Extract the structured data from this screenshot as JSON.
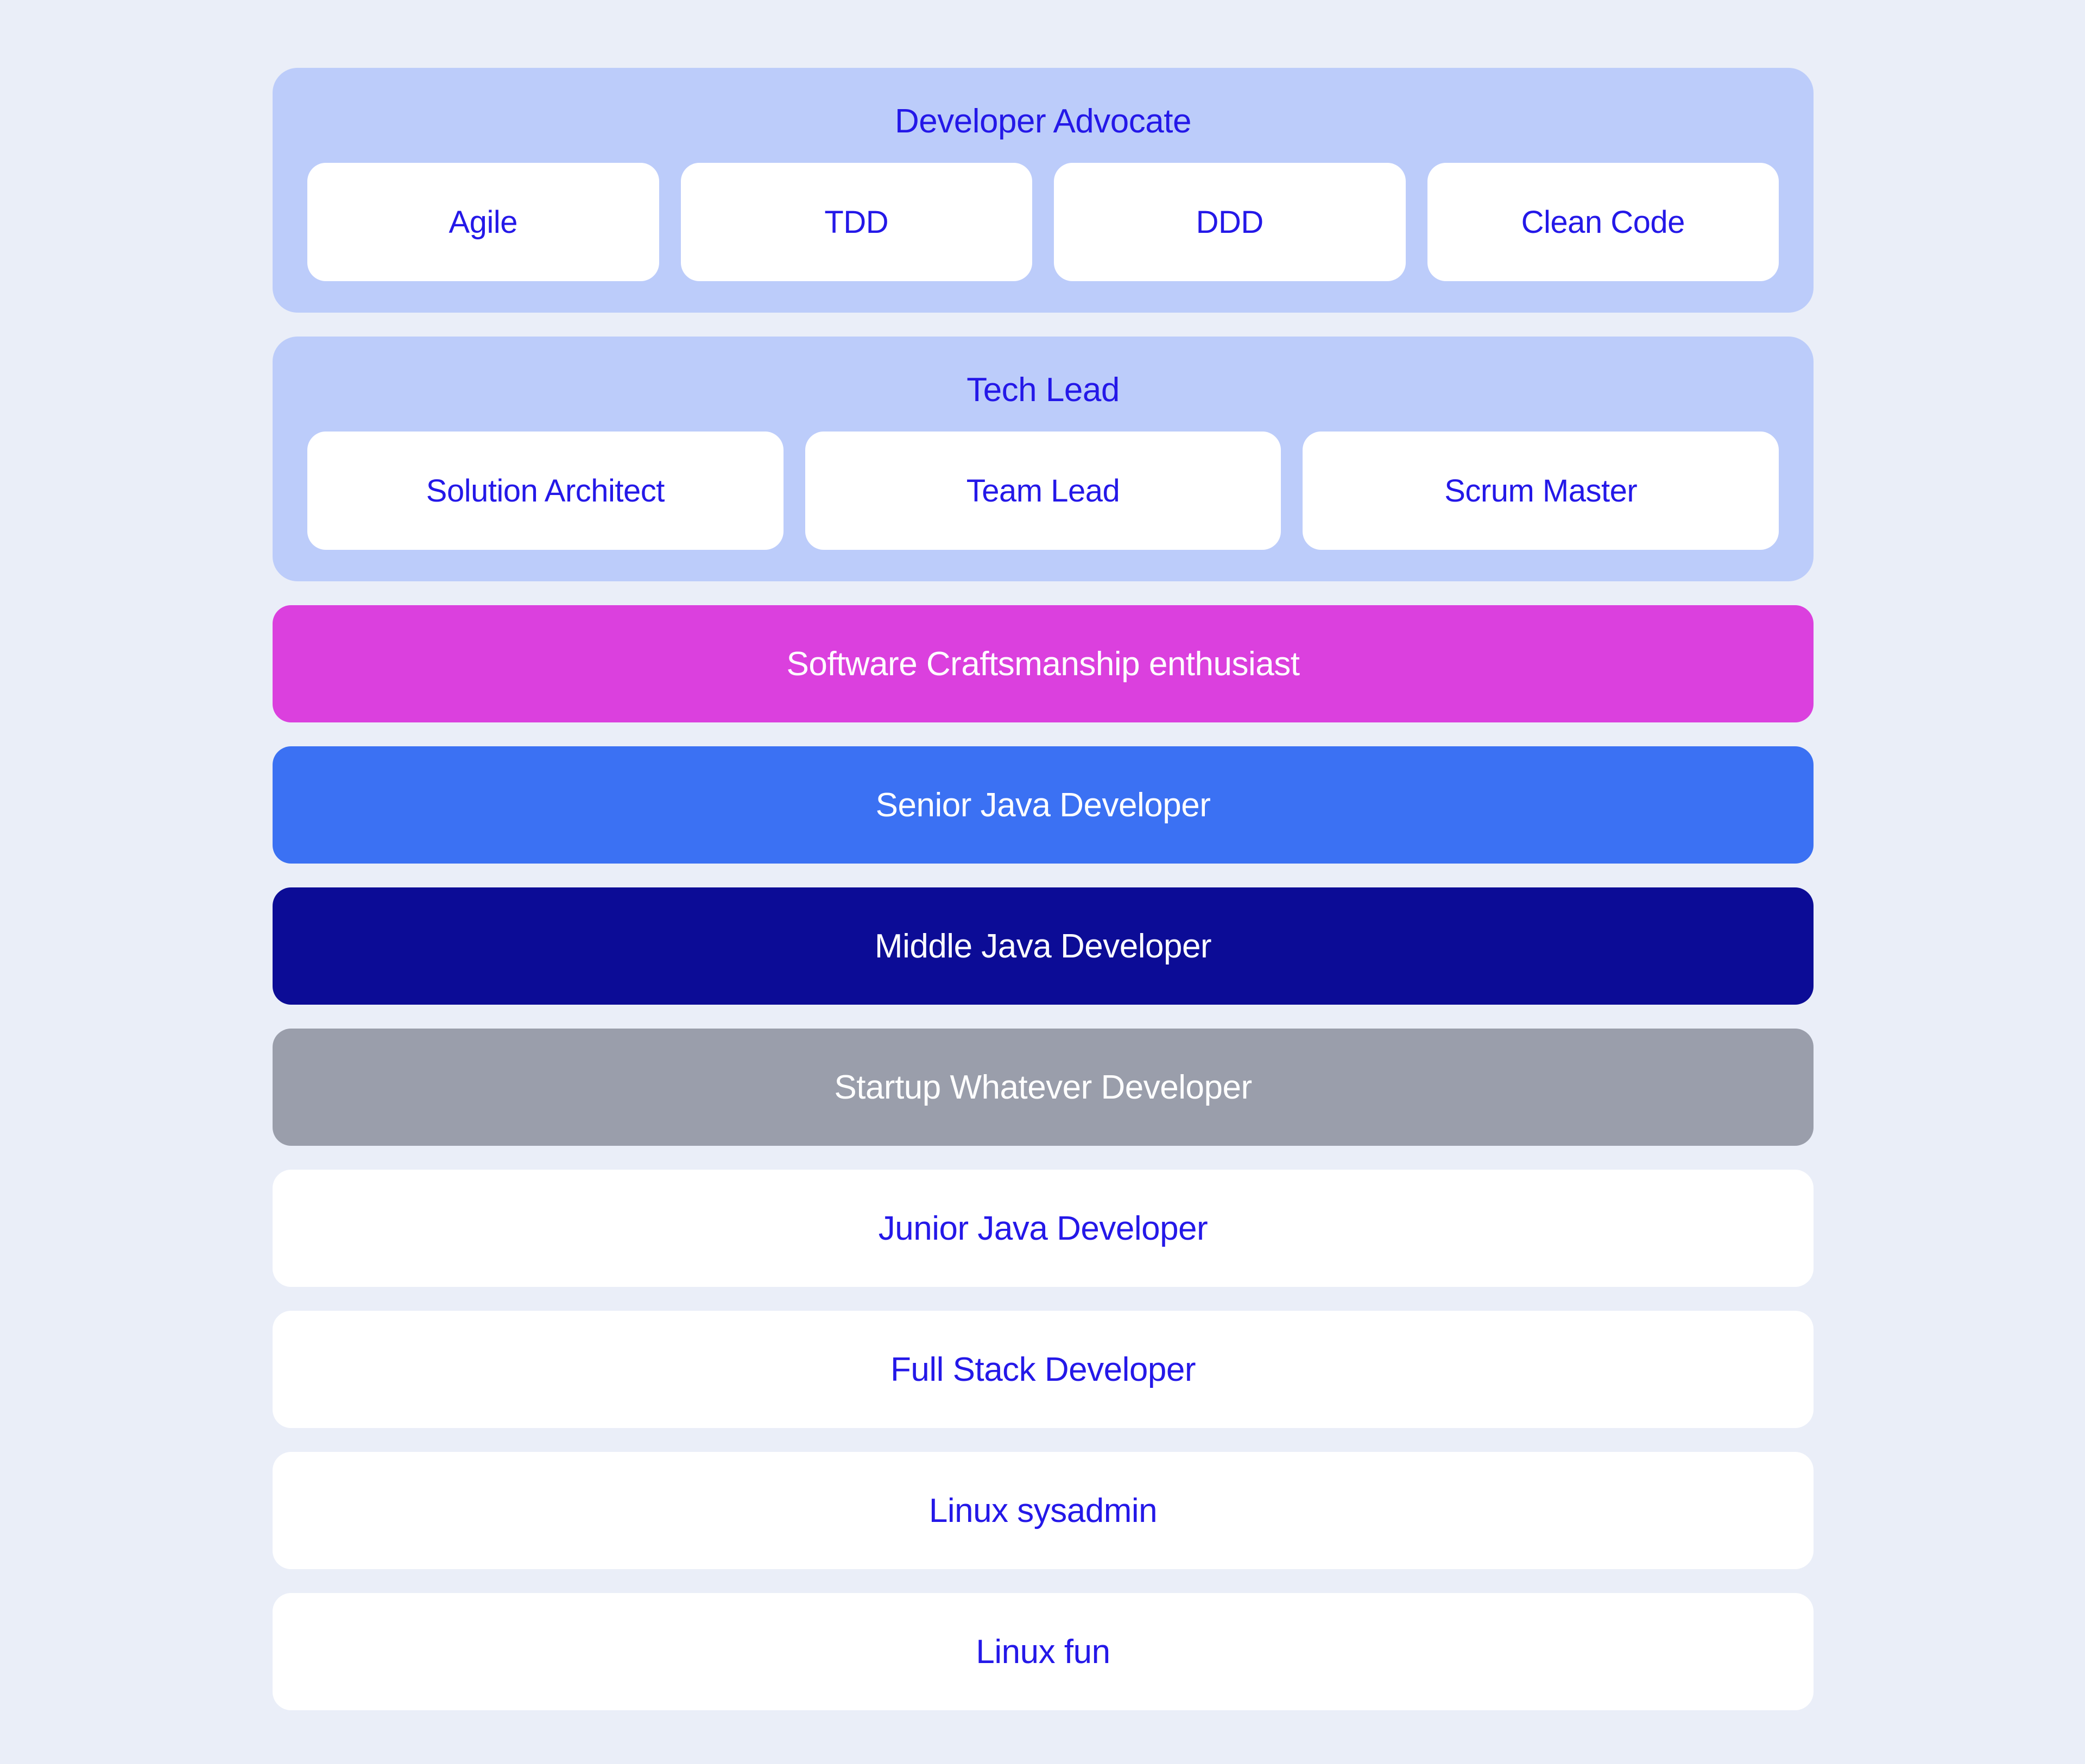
{
  "palette": {
    "page_background": "#EAEEF8",
    "group_card": "#BCCCFA",
    "pill_background": "#FFFFFF",
    "text_blue": "#2418E8",
    "text_white": "#FFFFFF",
    "magenta": "#DB40DE",
    "royal_blue": "#3B71F3",
    "navy": "#0C0C96",
    "gray": "#9A9EAB"
  },
  "career_stack": {
    "groups": [
      {
        "id": "developer-advocate",
        "title": "Developer Advocate",
        "pills": [
          {
            "label": "Agile"
          },
          {
            "label": "TDD"
          },
          {
            "label": "DDD"
          },
          {
            "label": "Clean Code"
          }
        ]
      },
      {
        "id": "tech-lead",
        "title": "Tech Lead",
        "pills": [
          {
            "label": "Solution Architect"
          },
          {
            "label": "Team Lead"
          },
          {
            "label": "Scrum Master"
          }
        ]
      }
    ],
    "bars": [
      {
        "id": "software-craftsmanship-enthusiast",
        "label": "Software Craftsmanship enthusiast",
        "background": "#DB40DE",
        "text_color": "#FFFFFF"
      },
      {
        "id": "senior-java-developer",
        "label": "Senior Java Developer",
        "background": "#3B71F3",
        "text_color": "#FFFFFF"
      },
      {
        "id": "middle-java-developer",
        "label": "Middle Java Developer",
        "background": "#0C0C96",
        "text_color": "#FFFFFF"
      },
      {
        "id": "startup-whatever-developer",
        "label": "Startup Whatever Developer",
        "background": "#9A9EAB",
        "text_color": "#FFFFFF"
      },
      {
        "id": "junior-java-developer",
        "label": "Junior Java Developer",
        "background": "#FFFFFF",
        "text_color": "#2418E8"
      },
      {
        "id": "full-stack-developer",
        "label": "Full Stack Developer",
        "background": "#FFFFFF",
        "text_color": "#2418E8"
      },
      {
        "id": "linux-sysadmin",
        "label": "Linux sysadmin",
        "background": "#FFFFFF",
        "text_color": "#2418E8"
      },
      {
        "id": "linux-fun",
        "label": "Linux fun",
        "background": "#FFFFFF",
        "text_color": "#2418E8"
      }
    ]
  }
}
